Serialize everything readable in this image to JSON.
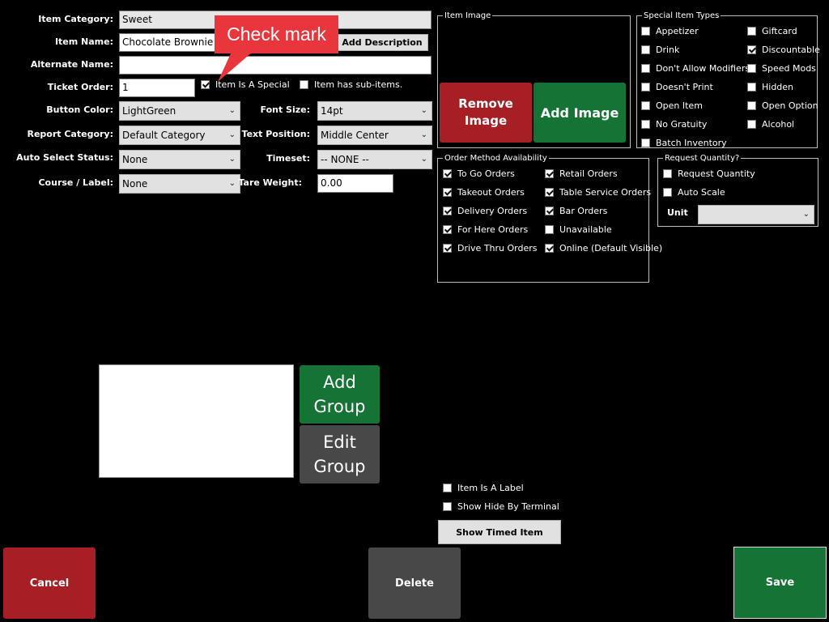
{
  "form": {
    "item_category": {
      "label": "Item Category:",
      "value": "Sweet"
    },
    "item_name": {
      "label": "Item Name:",
      "value": "Chocolate Brownie"
    },
    "add_description_label": "Add Description",
    "alternate_name": {
      "label": "Alternate Name:",
      "value": ""
    },
    "ticket_order": {
      "label": "Ticket Order:",
      "value": "1"
    },
    "item_is_special": {
      "label": "Item Is A Special",
      "checked": true
    },
    "has_sub_items": {
      "label": "Item has sub-items.",
      "checked": false
    },
    "button_color": {
      "label": "Button Color:",
      "value": "LightGreen"
    },
    "font_size": {
      "label": "Font Size:",
      "value": "14pt"
    },
    "report_category": {
      "label": "Report Category:",
      "value": "Default Category"
    },
    "text_position": {
      "label": "Text Position:",
      "value": "Middle Center"
    },
    "auto_select_status": {
      "label": "Auto Select Status:",
      "value": "None"
    },
    "timeset": {
      "label": "Timeset:",
      "value": "-- NONE --"
    },
    "course_label": {
      "label": "Course / Label:",
      "value": "None"
    },
    "tare_weight": {
      "label": "Tare Weight:",
      "value": "0.00"
    }
  },
  "callout": {
    "text": "Check mark",
    "color": "#e8363c"
  },
  "item_image": {
    "legend": "Item Image",
    "remove_label": "Remove Image",
    "add_label": "Add Image"
  },
  "special_types": {
    "legend": "Special Item Types",
    "items": [
      {
        "label": "Appetizer",
        "checked": false
      },
      {
        "label": "Giftcard",
        "checked": false
      },
      {
        "label": "Drink",
        "checked": false
      },
      {
        "label": "Discountable",
        "checked": true
      },
      {
        "label": "Don't Allow Modifiers",
        "checked": false
      },
      {
        "label": "Speed Mods",
        "checked": false
      },
      {
        "label": "Doesn't Print",
        "checked": false
      },
      {
        "label": "Hidden",
        "checked": false
      },
      {
        "label": "Open Item",
        "checked": false
      },
      {
        "label": "Open Option",
        "checked": false
      },
      {
        "label": "No Gratuity",
        "checked": false
      },
      {
        "label": "Alcohol",
        "checked": false
      },
      {
        "label": "Batch Inventory",
        "checked": false
      }
    ]
  },
  "order_methods": {
    "legend": "Order Method Availability",
    "items": [
      {
        "label": "To Go Orders",
        "checked": true
      },
      {
        "label": "Retail Orders",
        "checked": true
      },
      {
        "label": "Takeout Orders",
        "checked": true
      },
      {
        "label": "Table Service Orders",
        "checked": true
      },
      {
        "label": "Delivery Orders",
        "checked": true
      },
      {
        "label": "Bar Orders",
        "checked": true
      },
      {
        "label": "For Here Orders",
        "checked": true
      },
      {
        "label": "Unavailable",
        "checked": false
      },
      {
        "label": "Drive Thru Orders",
        "checked": true
      },
      {
        "label": "Online (Default Visible)",
        "checked": true
      }
    ]
  },
  "request_quantity": {
    "legend": "Request Quantity?",
    "request_label": "Request Quantity",
    "request_checked": false,
    "auto_scale_label": "Auto Scale",
    "auto_scale_checked": false,
    "unit_label": "Unit",
    "unit_value": ""
  },
  "groups": {
    "add_label": "Add Group",
    "edit_label": "Edit Group"
  },
  "misc": {
    "item_is_label": {
      "label": "Item Is A Label",
      "checked": false
    },
    "show_hide_terminal": {
      "label": "Show Hide By Terminal",
      "checked": false
    },
    "show_timed_item_label": "Show Timed Item"
  },
  "footer": {
    "cancel_label": "Cancel",
    "delete_label": "Delete",
    "save_label": "Save"
  },
  "colors": {
    "red": "#a51f24",
    "green": "#157336",
    "gray": "#484848"
  }
}
